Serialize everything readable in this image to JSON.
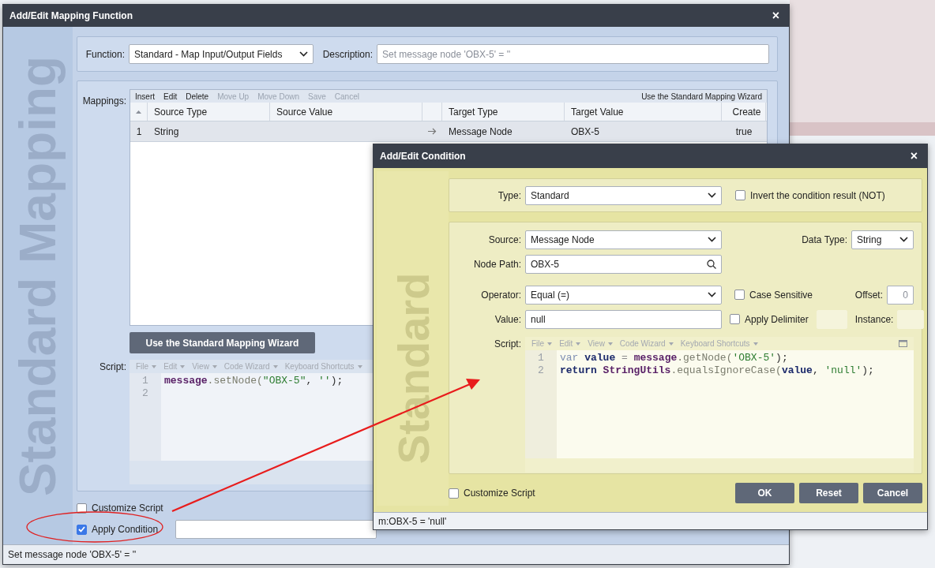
{
  "mapping_dialog": {
    "title": "Add/Edit Mapping Function",
    "close": "×",
    "watermark": "Standard Mapping",
    "function": {
      "label": "Function:",
      "value": "Standard - Map Input/Output Fields"
    },
    "description": {
      "label": "Description:",
      "placeholder": "Set message node 'OBX-5' = ''"
    },
    "mappings": {
      "label": "Mappings:",
      "toolbar": [
        {
          "label": "Insert",
          "disabled": false
        },
        {
          "label": "Edit",
          "disabled": false
        },
        {
          "label": "Delete",
          "disabled": false
        },
        {
          "label": "Move Up",
          "disabled": true
        },
        {
          "label": "Move Down",
          "disabled": true
        },
        {
          "label": "Save",
          "disabled": true
        },
        {
          "label": "Cancel",
          "disabled": true
        }
      ],
      "wizard_link": "Use the Standard Mapping Wizard",
      "columns": [
        "Source Type",
        "Source Value",
        "Target Type",
        "Target Value",
        "Create"
      ],
      "rows": [
        {
          "number": "1",
          "source_type": "String",
          "target_type": "Message Node",
          "target_value": "OBX-5",
          "create": "true",
          "selected": true
        }
      ]
    },
    "wizard_button": "Use the Standard Mapping Wizard",
    "script": {
      "label": "Script:",
      "menus": [
        "File",
        "Edit",
        "View",
        "Code Wizard",
        "Keyboard Shortcuts"
      ],
      "lines": [
        {
          "number": "1",
          "tokens": [
            {
              "text": "message",
              "kind": "object"
            },
            {
              "text": ".setNode(",
              "kind": "method"
            },
            {
              "text": "\"OBX-5\"",
              "kind": "string"
            },
            {
              "text": ", ",
              "kind": "punct"
            },
            {
              "text": "''",
              "kind": "string"
            },
            {
              "text": ");",
              "kind": "punct"
            }
          ]
        },
        {
          "number": "2"
        }
      ]
    },
    "options": [
      {
        "label": "Customize Script",
        "checked": false
      },
      {
        "label": "Apply Condition",
        "checked": true
      }
    ],
    "status": "Set message node 'OBX-5' = ''"
  },
  "condition_dialog": {
    "title": "Add/Edit Condition",
    "close": "×",
    "watermark": "Standard",
    "type": {
      "label": "Type:",
      "value": "Standard"
    },
    "invert": {
      "label": "Invert the condition result (NOT)",
      "checked": false
    },
    "source": {
      "label": "Source:",
      "value": "Message Node"
    },
    "data_type": {
      "label": "Data Type:",
      "value": "String"
    },
    "node_path": {
      "label": "Node Path:",
      "value": "OBX-5"
    },
    "operator": {
      "label": "Operator:",
      "value": "Equal (=)"
    },
    "case_sensitive": {
      "label": "Case Sensitive",
      "checked": false
    },
    "offset": {
      "label": "Offset:",
      "placeholder": "0"
    },
    "value": {
      "label": "Value:",
      "value": "null"
    },
    "apply_delimiter": {
      "label": "Apply Delimiter",
      "checked": false
    },
    "instance": {
      "label": "Instance:"
    },
    "script": {
      "label": "Script:",
      "menus": [
        "File",
        "Edit",
        "View",
        "Code Wizard",
        "Keyboard Shortcuts"
      ],
      "lines": [
        {
          "number": "1",
          "tokens": [
            {
              "text": "var ",
              "kind": "declaration"
            },
            {
              "text": "value",
              "kind": "variable"
            },
            {
              "text": " = ",
              "kind": "operator"
            },
            {
              "text": "message",
              "kind": "object"
            },
            {
              "text": ".getNode(",
              "kind": "method"
            },
            {
              "text": "'OBX-5'",
              "kind": "string"
            },
            {
              "text": ");",
              "kind": "punct"
            }
          ]
        },
        {
          "number": "2",
          "tokens": [
            {
              "text": "return ",
              "kind": "keyword"
            },
            {
              "text": "StringUtils",
              "kind": "object"
            },
            {
              "text": ".equalsIgnoreCase(",
              "kind": "method"
            },
            {
              "text": "value",
              "kind": "variable"
            },
            {
              "text": ", ",
              "kind": "punct"
            },
            {
              "text": "'null'",
              "kind": "string"
            },
            {
              "text": ");",
              "kind": "punct"
            }
          ]
        }
      ]
    },
    "customize": {
      "label": "Customize Script",
      "checked": false
    },
    "buttons": [
      "OK",
      "Reset",
      "Cancel"
    ],
    "status": "m:OBX-5 = 'null'"
  }
}
